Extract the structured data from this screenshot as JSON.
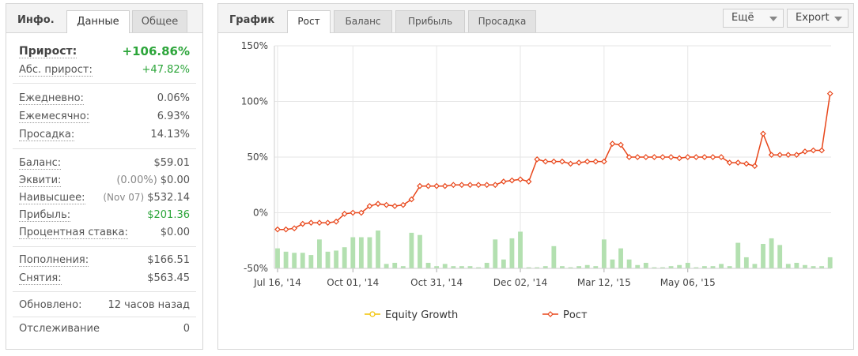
{
  "info": {
    "title": "Инфо.",
    "tabs": [
      "Данные",
      "Общее"
    ],
    "growth_label": "Прирост:",
    "growth_value": "+106.86%",
    "abs_growth_label": "Абс. прирост:",
    "abs_growth_value": "+47.82%",
    "daily_label": "Ежедневно:",
    "daily_value": "0.06%",
    "monthly_label": "Ежемесячно:",
    "monthly_value": "6.93%",
    "drawdown_label": "Просадка:",
    "drawdown_value": "14.13%",
    "balance_label": "Баланс:",
    "balance_value": "$59.01",
    "equity_label": "Эквити:",
    "equity_note": "(0.00%)",
    "equity_value": "$0.00",
    "highest_label": "Наивысшее:",
    "highest_note": "(Nov 07)",
    "highest_value": "$532.14",
    "profit_label": "Прибыль:",
    "profit_value": "$201.36",
    "interest_label": "Процентная ставка:",
    "interest_value": "$0.00",
    "deposits_label": "Пополнения:",
    "deposits_value": "$166.51",
    "withdrawals_label": "Снятия:",
    "withdrawals_value": "$563.45",
    "updated_label": "Обновлено:",
    "updated_value": "12 часов назад",
    "tracking_label": "Отслеживание",
    "tracking_value": "0"
  },
  "graph": {
    "title": "График",
    "tabs": [
      "Рост",
      "Баланс",
      "Прибыль",
      "Просадка"
    ],
    "more_label": "Ещё",
    "export_label": "Export"
  },
  "colors": {
    "growth_line": "#e8461a",
    "equity_line": "#f2c200",
    "bars": "#b3e0b0",
    "positive": "#2ca53a"
  },
  "chart_data": {
    "type": "line",
    "ylim": [
      -50,
      150
    ],
    "yticks": [
      "150%",
      "100%",
      "50%",
      "0%",
      "-50%"
    ],
    "ytick_values": [
      150,
      100,
      50,
      0,
      -50
    ],
    "xtick_labels": [
      "Jul 16, '14",
      "Oct 01, '14",
      "Oct 31, '14",
      "Dec 02, '14",
      "Mar 12, '15",
      "May 06, '15"
    ],
    "xtick_indices": [
      0,
      9,
      19,
      29,
      39,
      49
    ],
    "legend": [
      "Equity Growth",
      "Рост"
    ],
    "series": [
      {
        "name": "Рост",
        "values": [
          -15,
          -15,
          -14,
          -10,
          -9,
          -9,
          -9,
          -8,
          -1,
          0,
          0,
          6,
          8,
          7,
          6,
          7,
          12,
          24,
          24,
          24,
          24,
          25,
          25,
          25,
          25,
          25,
          25,
          28,
          29,
          30,
          28,
          48,
          46,
          46,
          46,
          44,
          45,
          46,
          46,
          46,
          62,
          61,
          50,
          50,
          50,
          50,
          50,
          50,
          49,
          50,
          50,
          50,
          50,
          50,
          45,
          45,
          44,
          42,
          71,
          52,
          52,
          52,
          52,
          55,
          56,
          56,
          107
        ]
      },
      {
        "name": "Equity Growth",
        "values": []
      }
    ],
    "bars": [
      -32,
      -35,
      -36,
      -36,
      -38,
      -24,
      -35,
      -34,
      -31,
      -22,
      -22,
      -22,
      -16,
      -46,
      -45,
      -48,
      -18,
      -20,
      -45,
      -48,
      -46,
      -48,
      -48,
      -48,
      -49,
      -45,
      -24,
      -42,
      -23,
      -17,
      -49,
      -49,
      -48,
      -30,
      -48,
      -49,
      -48,
      -47,
      -48,
      -24,
      -42,
      -32,
      -42,
      -47,
      -45,
      -49,
      -49,
      -48,
      -47,
      -45,
      -49,
      -48,
      -48,
      -46,
      -48,
      -27,
      -40,
      -46,
      -28,
      -23,
      -29,
      -46,
      -45,
      -47,
      -48,
      -48,
      -40
    ]
  }
}
